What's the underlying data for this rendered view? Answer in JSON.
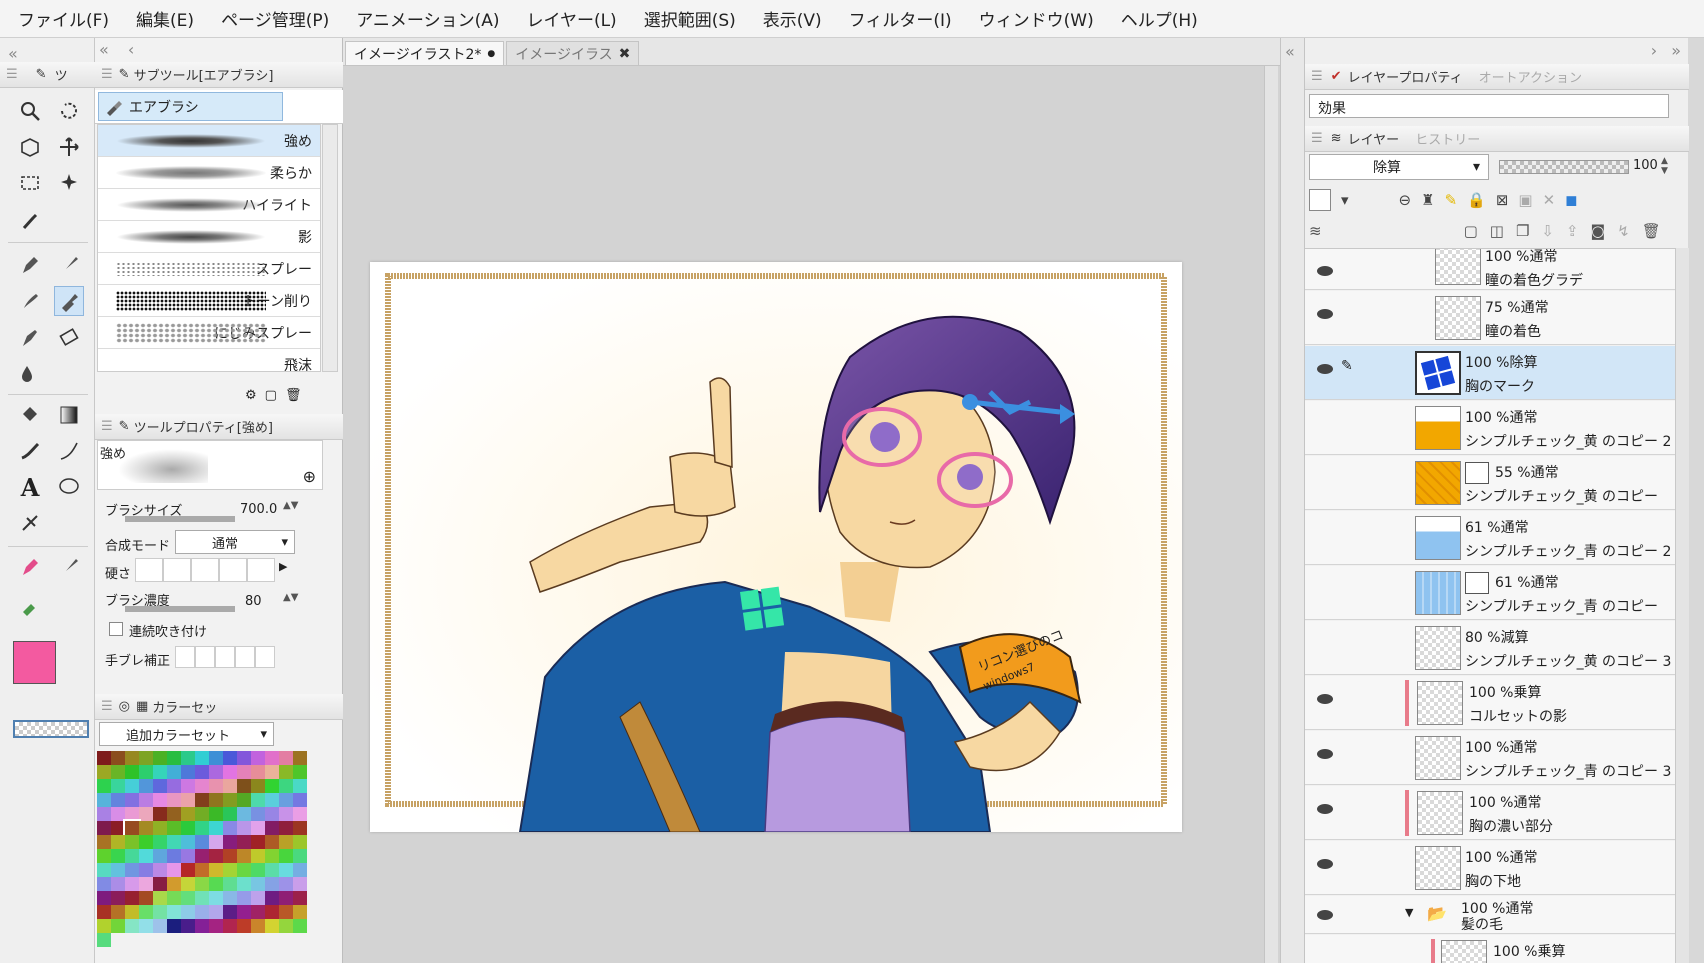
{
  "menu": [
    "ファイル(F)",
    "編集(E)",
    "ページ管理(P)",
    "アニメーション(A)",
    "レイヤー(L)",
    "選択範囲(S)",
    "表示(V)",
    "フィルター(I)",
    "ウィンドウ(W)",
    "ヘルプ(H)"
  ],
  "tool_panel_tab": "ツ",
  "subtool": {
    "header": "サブツール[エアブラシ]",
    "group": "エアブラシ",
    "brushes": [
      "強め",
      "柔らか",
      "ハイライト",
      "影",
      "スプレー",
      "トーン削り",
      "にじみスプレー",
      "飛沫"
    ]
  },
  "tool_property": {
    "header": "ツールプロパティ[強め]",
    "preview_label": "強め",
    "brush_size_label": "ブラシサイズ",
    "brush_size_value": "700.0",
    "blend_mode_label": "合成モード",
    "blend_mode_value": "通常",
    "hardness_label": "硬さ",
    "density_label": "ブラシ濃度",
    "density_value": "80",
    "continuous_label": "連続吹き付け",
    "stabilizer_label": "手ブレ補正"
  },
  "color_set": {
    "header": "カラーセッ",
    "selected": "追加カラーセット"
  },
  "colors": {
    "main": "#f35aa0",
    "sub": "#fdf4c2",
    "accent": "#8fb6dd"
  },
  "doc_tabs": [
    "イメージイラスト2*",
    "イメージイラス"
  ],
  "right_panel": {
    "tab_layer_property": "レイヤープロパティ",
    "tab_auto_action": "オートアクション",
    "effect_label": "効果",
    "tab_layer": "レイヤー",
    "tab_history": "ヒストリー",
    "blend_mode": "除算",
    "opacity": "100"
  },
  "layers": [
    {
      "meta": "100 %通常",
      "name": "瞳の着色グラデ"
    },
    {
      "meta": "75 %通常",
      "name": "瞳の着色"
    },
    {
      "meta": "100 %除算",
      "name": "胸のマーク"
    },
    {
      "meta": "100 %通常",
      "name": "シンプルチェック_黄 のコピー 2"
    },
    {
      "meta": "55 %通常",
      "name": "シンプルチェック_黄 のコピー"
    },
    {
      "meta": "61 %通常",
      "name": "シンプルチェック_青 のコピー 2"
    },
    {
      "meta": "61 %通常",
      "name": "シンプルチェック_青 のコピー"
    },
    {
      "meta": "80 %減算",
      "name": "シンプルチェック_黄 のコピー 3"
    },
    {
      "meta": "100 %乗算",
      "name": "コルセットの影"
    },
    {
      "meta": "100 %通常",
      "name": "シンプルチェック_青 のコピー 3"
    },
    {
      "meta": "100 %通常",
      "name": "胸の濃い部分"
    },
    {
      "meta": "100 %通常",
      "name": "胸の下地"
    },
    {
      "meta": "100 %通常",
      "name": "髪の毛"
    },
    {
      "meta": "100 %乗算",
      "name": ""
    }
  ],
  "artwork": {
    "armband_text": "リコン選びのコ",
    "armband_sub": "windows7"
  }
}
